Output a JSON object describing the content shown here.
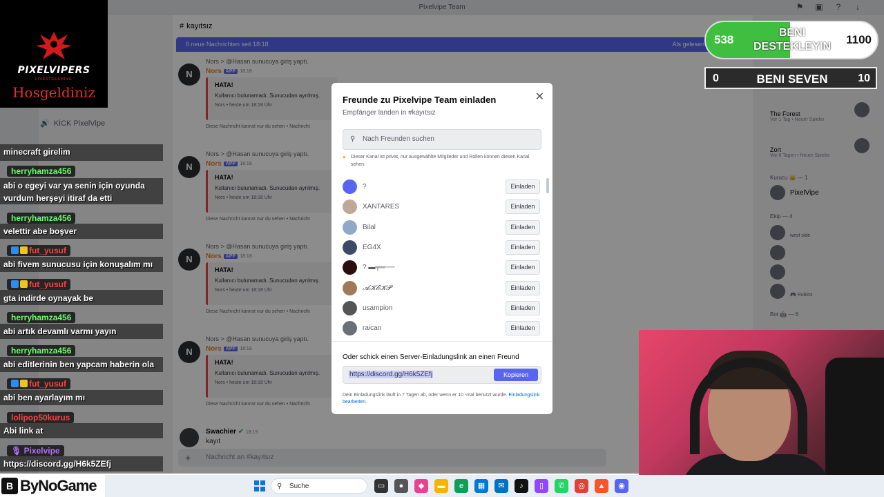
{
  "window": {
    "title": "Pixelvipe Team"
  },
  "channel": {
    "name": "kayıtsız",
    "hash": "#"
  },
  "sidebar": {
    "kick_label": "KİCK PixelVipe"
  },
  "new_messages_bar": {
    "text": "6 neue Nachrichten seit 18:18",
    "right": "Als gelesen"
  },
  "bot_messages": [
    {
      "line": "Nors > @Hasan sunucuya giriş yaptı.",
      "author": "Nors",
      "badge": "APP",
      "time": "18:18",
      "embed_title": "HATA!",
      "embed_text": "Kullanıcı bulunamadı. Sunucudan ayrılmış.",
      "embed_footer": "Nors • heute um 18:18 Uhr",
      "ephemeral": "Diese Nachricht kannst nur du sehen • Nachricht"
    },
    {
      "line": "Nors > @Hasan sunucuya giriş yaptı.",
      "author": "Nors",
      "badge": "APP",
      "time": "18:18",
      "embed_title": "HATA!",
      "embed_text": "Kullanıcı bulunamadı. Sunucudan ayrılmış.",
      "embed_footer": "Nors • heute um 18:18 Uhr",
      "ephemeral": "Diese Nachricht kannst nur du sehen • Nachricht"
    },
    {
      "line": "Nors > @Hasan sunucuya giriş yaptı.",
      "author": "Nors",
      "badge": "APP",
      "time": "18:18",
      "embed_title": "HATA!",
      "embed_text": "Kullanıcı bulunamadı. Sunucudan ayrılmış.",
      "embed_footer": "Nors • heute um 18:18 Uhr",
      "ephemeral": "Diese Nachricht kannst nur du sehen • Nachricht"
    },
    {
      "line": "Nors > @Hasan sunucuya giriş yaptı.",
      "author": "Nors",
      "badge": "APP",
      "time": "18:18",
      "embed_title": "HATA!",
      "embed_text": "Kullanıcı bulunamadı. Sunucudan ayrılmış.",
      "embed_footer": "Nors • heute um 18:18 Uhr",
      "ephemeral": "Diese Nachricht kannst nur du sehen • Nachricht"
    }
  ],
  "last_message": {
    "author": "Swachier",
    "time": "18:19",
    "text": "kayıt"
  },
  "composer": {
    "placeholder": "Nachricht an #kayıtsız"
  },
  "members": {
    "the_forest": {
      "name": "The Forest",
      "sub": "Vor 1 Tag  •  Neuer Spieler"
    },
    "zort": {
      "name": "Zort",
      "sub": "Vor 6 Tagen  •  Neuer Spieler"
    },
    "kurucu_head": "Kurucu 👑 — 1",
    "pixelvipe": "PixelVipe",
    "ekip_head": "Ekip — 4",
    "west_side": "west side",
    "roblox": "Roblox",
    "bot_head": "Bot 🤖 — 6"
  },
  "modal": {
    "title": "Freunde zu Pixelvipe Team einladen",
    "subtitle": "Empfänger landen in #kayıtsız",
    "close": "✕",
    "search_placeholder": "Nach Freunden suchen",
    "notice": "Dieser Kanal ist privat, nur ausgewählte Mitglieder und Rollen können diesen Kanal sehen.",
    "friends": [
      {
        "name": "?",
        "button": "Einladen"
      },
      {
        "name": "XANTARES",
        "button": "Einladen"
      },
      {
        "name": "Bilal",
        "button": "Einladen"
      },
      {
        "name": "EG4X",
        "button": "Einladen"
      },
      {
        "name": "? ▬╤═──",
        "button": "Einladen"
      },
      {
        "name": "𝓐𝓚𝓔𝓚𝓟",
        "button": "Einladen"
      },
      {
        "name": "usampion",
        "button": "Einladen"
      },
      {
        "name": "raican",
        "button": "Einladen"
      }
    ],
    "link_label": "Oder schick einen Server-Einladungslink an einen Freund",
    "link_url": "https://discord.gg/H6k5ZEfj",
    "copy_button": "Kopieren",
    "expiry_text": "Dein Einladungslink läuft in 7 Tagen ab, oder wenn er 10 -mal benutzt wurde.",
    "expiry_edit": "Einladungslink bearbeiten."
  },
  "stream": {
    "logo_title": "PIXELVIPERS",
    "logo_sub": "LIVESTREAMING",
    "logo_greeting": "Hosgeldiniz",
    "chat": [
      {
        "type": "msg",
        "text": "minecraft girelim"
      },
      {
        "type": "user",
        "color": "green",
        "text": "herryhamza456"
      },
      {
        "type": "msg",
        "text": "abi o egeyi var ya senin için oyunda"
      },
      {
        "type": "msg",
        "text": "vurdum herşeyi itiraf da etti"
      },
      {
        "type": "user",
        "color": "green",
        "text": "herryhamza456"
      },
      {
        "type": "msg",
        "text": "velettir abe boşver"
      },
      {
        "type": "user",
        "color": "red",
        "text": "fut_yusuf"
      },
      {
        "type": "msg",
        "text": "abi fivem sunucusu için konuşalım mı"
      },
      {
        "type": "user",
        "color": "red",
        "text": "fut_yusuf"
      },
      {
        "type": "msg",
        "text": "gta indirde oynayak be"
      },
      {
        "type": "user",
        "color": "green",
        "text": "herryhamza456"
      },
      {
        "type": "msg",
        "text": "abi artık devamlı varmı yayın"
      },
      {
        "type": "user",
        "color": "green",
        "text": "herryhamza456"
      },
      {
        "type": "msg",
        "text": "abi editlerinin ben yapcam haberin ola"
      },
      {
        "type": "user",
        "color": "red",
        "text": "fut_yusuf"
      },
      {
        "type": "msg",
        "text": "abi ben ayarlayım mı"
      },
      {
        "type": "user",
        "color": "red",
        "text": "lolipop50kurus"
      },
      {
        "type": "msg",
        "text": "Abi link at"
      },
      {
        "type": "user",
        "color": "purple",
        "text": "Pixelvipe"
      },
      {
        "type": "msg",
        "text": "https://discord.gg/H6k5ZEfj"
      }
    ],
    "bynogame": "ByNoGame",
    "goal1": {
      "left": "538",
      "label": "BENI DESTEKLEYIN",
      "right": "1100",
      "progress": 0.49
    },
    "goal2": {
      "left": "0",
      "label": "BENI SEVEN",
      "right": "10"
    }
  },
  "taskbar": {
    "search_label": "Suche"
  }
}
